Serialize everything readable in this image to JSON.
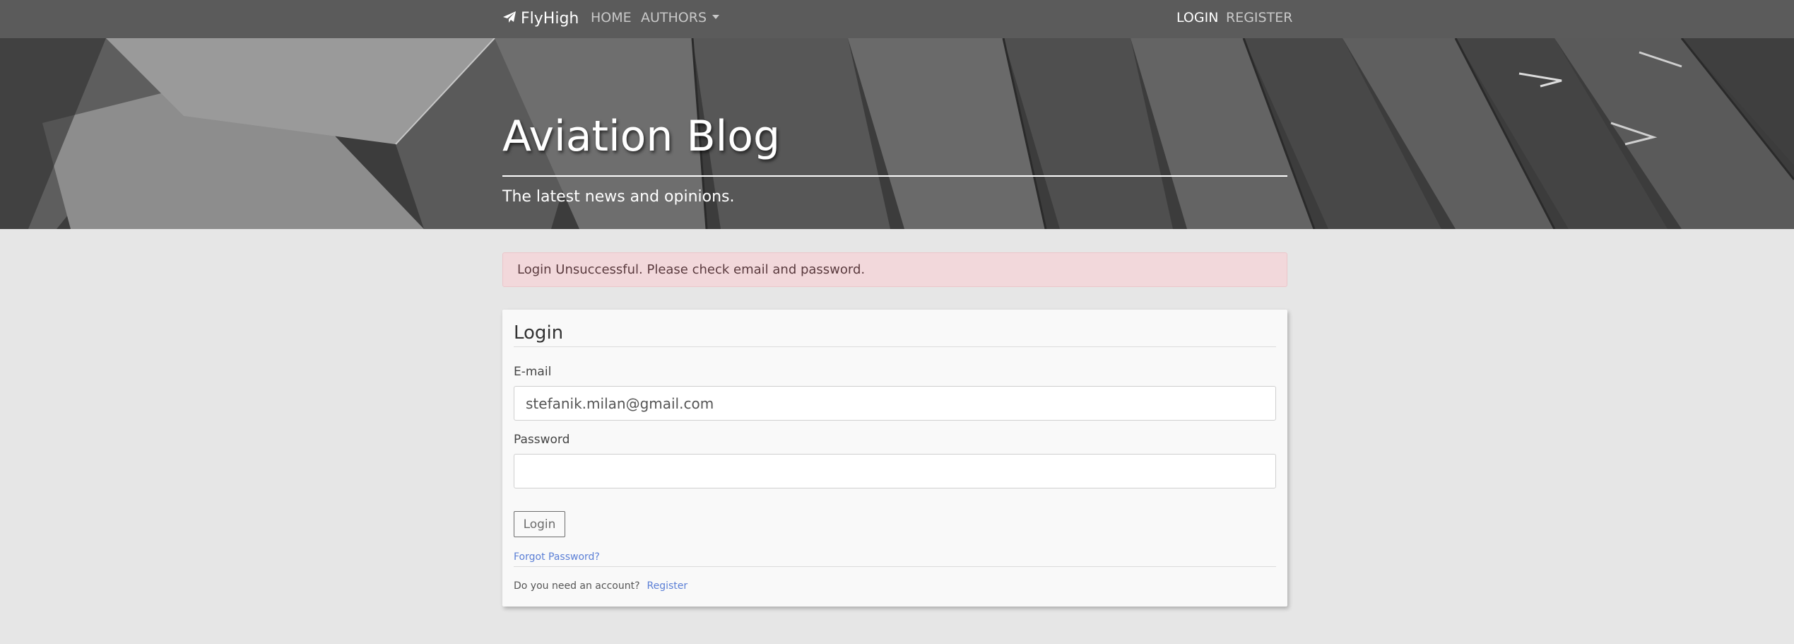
{
  "navbar": {
    "brand": "FlyHigh",
    "brand_icon": "paper-plane-icon",
    "links": {
      "home": "HOME",
      "authors": "AUTHORS",
      "login": "LOGIN",
      "register": "REGISTER"
    }
  },
  "hero": {
    "title": "Aviation Blog",
    "subtitle": "The latest news and opinions."
  },
  "alert": {
    "message": "Login Unsuccessful. Please check email and password."
  },
  "login_form": {
    "title": "Login",
    "email_label": "E-mail",
    "email_value": "stefanik.milan@gmail.com",
    "password_label": "Password",
    "password_value": "",
    "submit_label": "Login",
    "forgot_password": "Forgot Password?",
    "need_account": "Do you need an account?",
    "register_link": "Register"
  },
  "colors": {
    "navbar_bg": "#5b5b5b",
    "page_bg": "#e6e6e6",
    "alert_bg": "#f2d8db",
    "link": "#5b7fd6"
  }
}
